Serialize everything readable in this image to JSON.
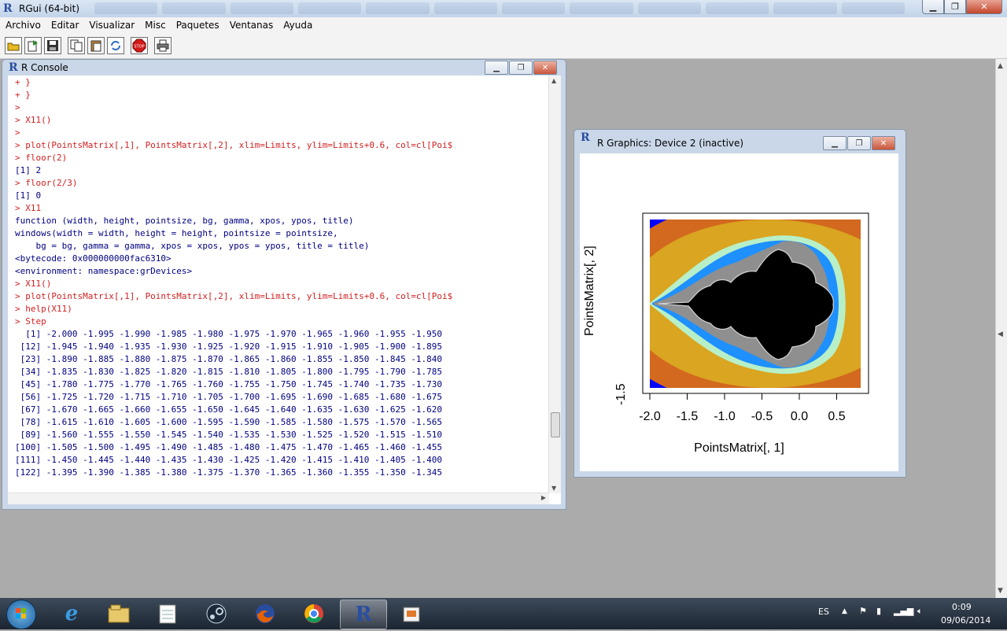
{
  "app": {
    "title": "RGui (64-bit)",
    "menu": [
      "Archivo",
      "Editar",
      "Visualizar",
      "Misc",
      "Paquetes",
      "Ventanas",
      "Ayuda"
    ],
    "toolbar_icons": [
      "open-script-icon",
      "load-workspace-icon",
      "save-icon",
      "copy-icon",
      "paste-icon",
      "copy-paste-icon",
      "stop-icon",
      "print-icon"
    ]
  },
  "console": {
    "title": "R Console",
    "lines": [
      {
        "t": "cmd",
        "s": "+ }"
      },
      {
        "t": "cmd",
        "s": "+ }"
      },
      {
        "t": "cmd",
        "s": ">"
      },
      {
        "t": "cmd",
        "s": "> X11()"
      },
      {
        "t": "cmd",
        "s": ">"
      },
      {
        "t": "cmd",
        "s": "> plot(PointsMatrix[,1], PointsMatrix[,2], xlim=Limits, ylim=Limits+0.6, col=cl[Poi$"
      },
      {
        "t": "cmd",
        "s": "> floor(2)"
      },
      {
        "t": "out",
        "s": "[1] 2"
      },
      {
        "t": "cmd",
        "s": "> floor(2/3)"
      },
      {
        "t": "out",
        "s": "[1] 0"
      },
      {
        "t": "cmd",
        "s": "> X11"
      },
      {
        "t": "out",
        "s": "function (width, height, pointsize, bg, gamma, xpos, ypos, title)"
      },
      {
        "t": "out",
        "s": "windows(width = width, height = height, pointsize = pointsize,"
      },
      {
        "t": "out",
        "s": "    bg = bg, gamma = gamma, xpos = xpos, ypos = ypos, title = title)"
      },
      {
        "t": "out",
        "s": "<bytecode: 0x000000000fac6310>"
      },
      {
        "t": "out",
        "s": "<environment: namespace:grDevices>"
      },
      {
        "t": "cmd",
        "s": "> X11()"
      },
      {
        "t": "cmd",
        "s": "> plot(PointsMatrix[,1], PointsMatrix[,2], xlim=Limits, ylim=Limits+0.6, col=cl[Poi$"
      },
      {
        "t": "cmd",
        "s": "> help(X11)"
      },
      {
        "t": "cmd",
        "s": "> Step"
      },
      {
        "t": "out",
        "s": "  [1] -2.000 -1.995 -1.990 -1.985 -1.980 -1.975 -1.970 -1.965 -1.960 -1.955 -1.950"
      },
      {
        "t": "out",
        "s": " [12] -1.945 -1.940 -1.935 -1.930 -1.925 -1.920 -1.915 -1.910 -1.905 -1.900 -1.895"
      },
      {
        "t": "out",
        "s": " [23] -1.890 -1.885 -1.880 -1.875 -1.870 -1.865 -1.860 -1.855 -1.850 -1.845 -1.840"
      },
      {
        "t": "out",
        "s": " [34] -1.835 -1.830 -1.825 -1.820 -1.815 -1.810 -1.805 -1.800 -1.795 -1.790 -1.785"
      },
      {
        "t": "out",
        "s": " [45] -1.780 -1.775 -1.770 -1.765 -1.760 -1.755 -1.750 -1.745 -1.740 -1.735 -1.730"
      },
      {
        "t": "out",
        "s": " [56] -1.725 -1.720 -1.715 -1.710 -1.705 -1.700 -1.695 -1.690 -1.685 -1.680 -1.675"
      },
      {
        "t": "out",
        "s": " [67] -1.670 -1.665 -1.660 -1.655 -1.650 -1.645 -1.640 -1.635 -1.630 -1.625 -1.620"
      },
      {
        "t": "out",
        "s": " [78] -1.615 -1.610 -1.605 -1.600 -1.595 -1.590 -1.585 -1.580 -1.575 -1.570 -1.565"
      },
      {
        "t": "out",
        "s": " [89] -1.560 -1.555 -1.550 -1.545 -1.540 -1.535 -1.530 -1.525 -1.520 -1.515 -1.510"
      },
      {
        "t": "out",
        "s": "[100] -1.505 -1.500 -1.495 -1.490 -1.485 -1.480 -1.475 -1.470 -1.465 -1.460 -1.455"
      },
      {
        "t": "out",
        "s": "[111] -1.450 -1.445 -1.440 -1.435 -1.430 -1.425 -1.420 -1.415 -1.410 -1.405 -1.400"
      },
      {
        "t": "out",
        "s": "[122] -1.395 -1.390 -1.385 -1.380 -1.375 -1.370 -1.365 -1.360 -1.355 -1.350 -1.345"
      }
    ]
  },
  "graphics": {
    "title": "R Graphics: Device 2 (inactive)",
    "xlabel": "PointsMatrix[, 1]",
    "ylabel": "PointsMatrix[, 2]",
    "xticks": [
      "-2.0",
      "-1.5",
      "-1.0",
      "-0.5",
      "0.0",
      "0.5"
    ],
    "yticks": [
      "-1.5"
    ],
    "colors": {
      "blue": "#0000ff",
      "orange": "#d2691e",
      "gold": "#daa520",
      "mint": "#b7f0c8",
      "sky": "#1e90ff",
      "black": "#000000"
    }
  },
  "taskbar": {
    "apps": [
      "internet-explorer-icon",
      "file-explorer-icon",
      "notepad-icon",
      "steam-icon",
      "firefox-icon",
      "chrome-icon",
      "r-gui-icon",
      "media-player-icon"
    ],
    "language": "ES",
    "time": "0:09",
    "date": "09/06/2014"
  }
}
